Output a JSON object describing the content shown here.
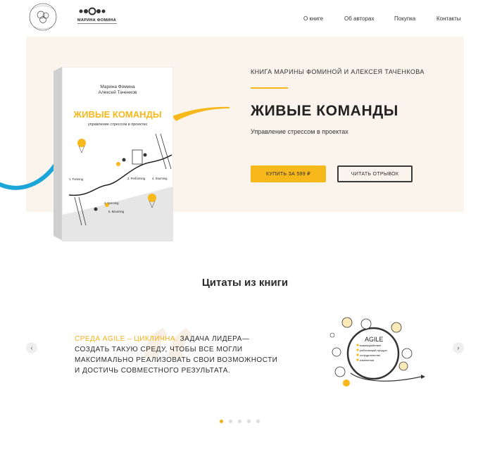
{
  "header": {
    "nav": [
      "О книге",
      "Об авторах",
      "Покупка",
      "Контакты"
    ],
    "logo2_text": "МАРИНА ФОМИНА"
  },
  "hero": {
    "kicker": "КНИГА МАРИНЫ ФОМИНОЙ И АЛЕКСЕЯ ТАЧЕНКОВА",
    "title": "ЖИВЫЕ КОМАНДЫ",
    "subtitle": "Управление стрессом в проектах",
    "buy_label": "КУПИТЬ ЗА 599 ₽",
    "read_label": "ЧИТАТЬ ОТРЫВОК",
    "book": {
      "authors_line1": "Марина Фомина",
      "authors_line2": "Алексей Таченков",
      "title": "ЖИВЫЕ КОМАНДЫ",
      "subtitle": "управление стрессом в проектах",
      "stages": [
        "1. Forming",
        "2. Norming",
        "3. Performing",
        "4. Storming",
        "5. Destroy",
        "6. Mourning"
      ]
    }
  },
  "quotes": {
    "title": "Цитаты из книги",
    "highlight": "Среда AGILE – цикличнa.",
    "text": " Задача лидера— создать такую среду, чтобы все могли максимально реализовать свои возможности и достичь совместного результата.",
    "prev_icon": "‹",
    "next_icon": "›",
    "illustration": {
      "label": "AGILE",
      "items": [
        "взаимодействие",
        "работающий продукт",
        "сотрудничество",
        "изменения"
      ]
    },
    "active_slide": 1,
    "slide_count": 5
  },
  "colors": {
    "accent": "#f7b81b",
    "hero_bg": "#faf4ec",
    "swoosh": "#1aa6d8"
  }
}
